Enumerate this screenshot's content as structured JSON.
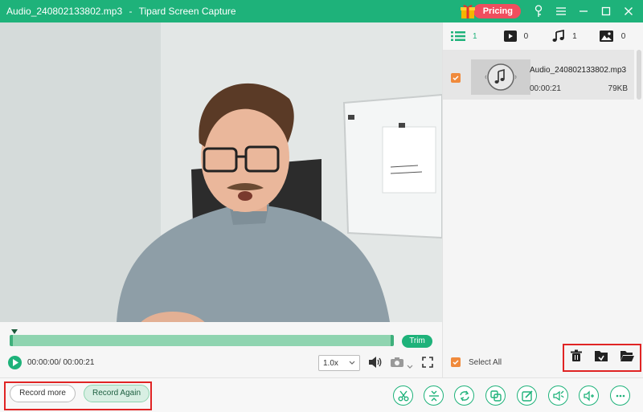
{
  "window": {
    "file_title": "Audio_240802133802.mp3",
    "separator": "-",
    "app_name": "Tipard Screen Capture",
    "pricing_label": "Pricing",
    "accent_color": "#1eb27a",
    "pricing_color": "#f04e5e"
  },
  "player": {
    "trim_label": "Trim",
    "time": "00:00:00/ 00:00:21",
    "speed": "1.0x"
  },
  "filters": [
    {
      "icon": "list-icon",
      "count": "1"
    },
    {
      "icon": "video-icon",
      "count": "0"
    },
    {
      "icon": "music-note-icon",
      "count": "1"
    },
    {
      "icon": "image-icon",
      "count": "0"
    }
  ],
  "file": {
    "name": "Audio_240802133802.mp3",
    "duration": "00:00:21",
    "size": "79KB",
    "checked": true
  },
  "panel": {
    "select_all_label": "Select All",
    "actions": [
      "trash-icon",
      "export-folder-icon",
      "open-folder-icon"
    ]
  },
  "bottom": {
    "record_more_label": "Record more",
    "record_again_label": "Record Again",
    "tools": [
      "scissors-icon",
      "merge-icon",
      "convert-icon",
      "compress-icon",
      "edit-icon",
      "volume-boost-icon",
      "audio-add-icon",
      "more-icon"
    ]
  }
}
